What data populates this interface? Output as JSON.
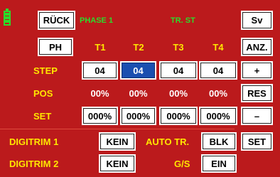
{
  "header": {
    "back_label": "RÜCK",
    "phase_label": "PHASE 1",
    "mode_label": "TR. ST",
    "sv_label": "Sv"
  },
  "grid": {
    "ph_label": "PH",
    "columns": [
      "T1",
      "T2",
      "T3",
      "T4"
    ],
    "rows": {
      "step": {
        "label": "STEP",
        "values": [
          "04",
          "04",
          "04",
          "04"
        ]
      },
      "pos": {
        "label": "POS",
        "values": [
          "00%",
          "00%",
          "00%",
          "00%"
        ]
      },
      "set": {
        "label": "SET",
        "values": [
          "000%",
          "000%",
          "000%",
          "000%"
        ]
      }
    }
  },
  "side": {
    "anz_label": "ANZ.",
    "plus_label": "+",
    "res_label": "RES",
    "minus_label": "–",
    "set_label": "SET"
  },
  "digitrim": {
    "row1_label": "DIGITRIM 1",
    "row1_value": "KEIN",
    "auto_label": "AUTO TR.",
    "auto_value": "BLK",
    "row2_label": "DIGITRIM 2",
    "row2_value": "KEIN",
    "gs_label": "G/S",
    "gs_value": "EIN"
  },
  "colors": {
    "background": "#bb1a1c",
    "label_yellow": "#ffe600",
    "header_green": "#2bdc2b",
    "selected_blue": "#1a4fb0"
  }
}
